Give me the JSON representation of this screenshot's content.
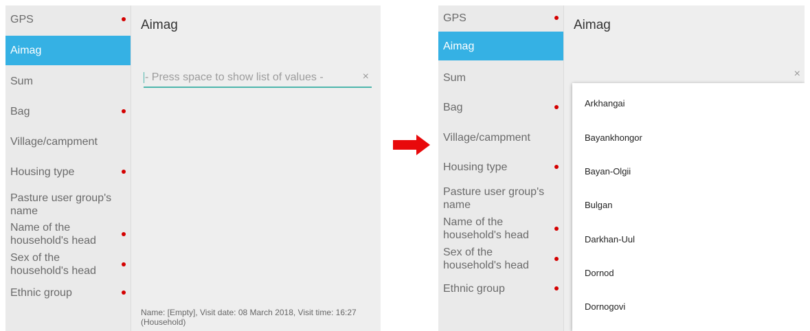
{
  "nav_items": [
    {
      "label": "GPS",
      "required": true
    },
    {
      "label": "Aimag",
      "required": false,
      "active": true
    },
    {
      "label": "Sum",
      "required": false
    },
    {
      "label": "Bag",
      "required": true
    },
    {
      "label": "Village/campment",
      "required": false
    },
    {
      "label": "Housing type",
      "required": true
    },
    {
      "label": "Pasture user group's name",
      "required": false
    },
    {
      "label": "Name of the household's head",
      "required": true
    },
    {
      "label": "Sex of the household's head",
      "required": true
    },
    {
      "label": "Ethnic group",
      "required": true
    }
  ],
  "question_title": "Aimag",
  "input": {
    "placeholder": "- Press space to show list of values -",
    "value": ""
  },
  "clear_glyph": "×",
  "footer_text": "Name: [Empty], Visit date: 08 March 2018, Visit time: 16:27 (Household)",
  "dropdown_options": [
    "Arkhangai",
    "Bayankhongor",
    "Bayan-Olgii",
    "Bulgan",
    "Darkhan-Uul",
    "Dornod",
    "Dornogovi"
  ],
  "colors": {
    "active": "#35b1e4",
    "required_dot": "#d40000",
    "underline": "#4db6ac",
    "arrow": "#e8090b"
  },
  "icons": {
    "clear": "close-icon",
    "transition": "right-arrow-icon"
  }
}
